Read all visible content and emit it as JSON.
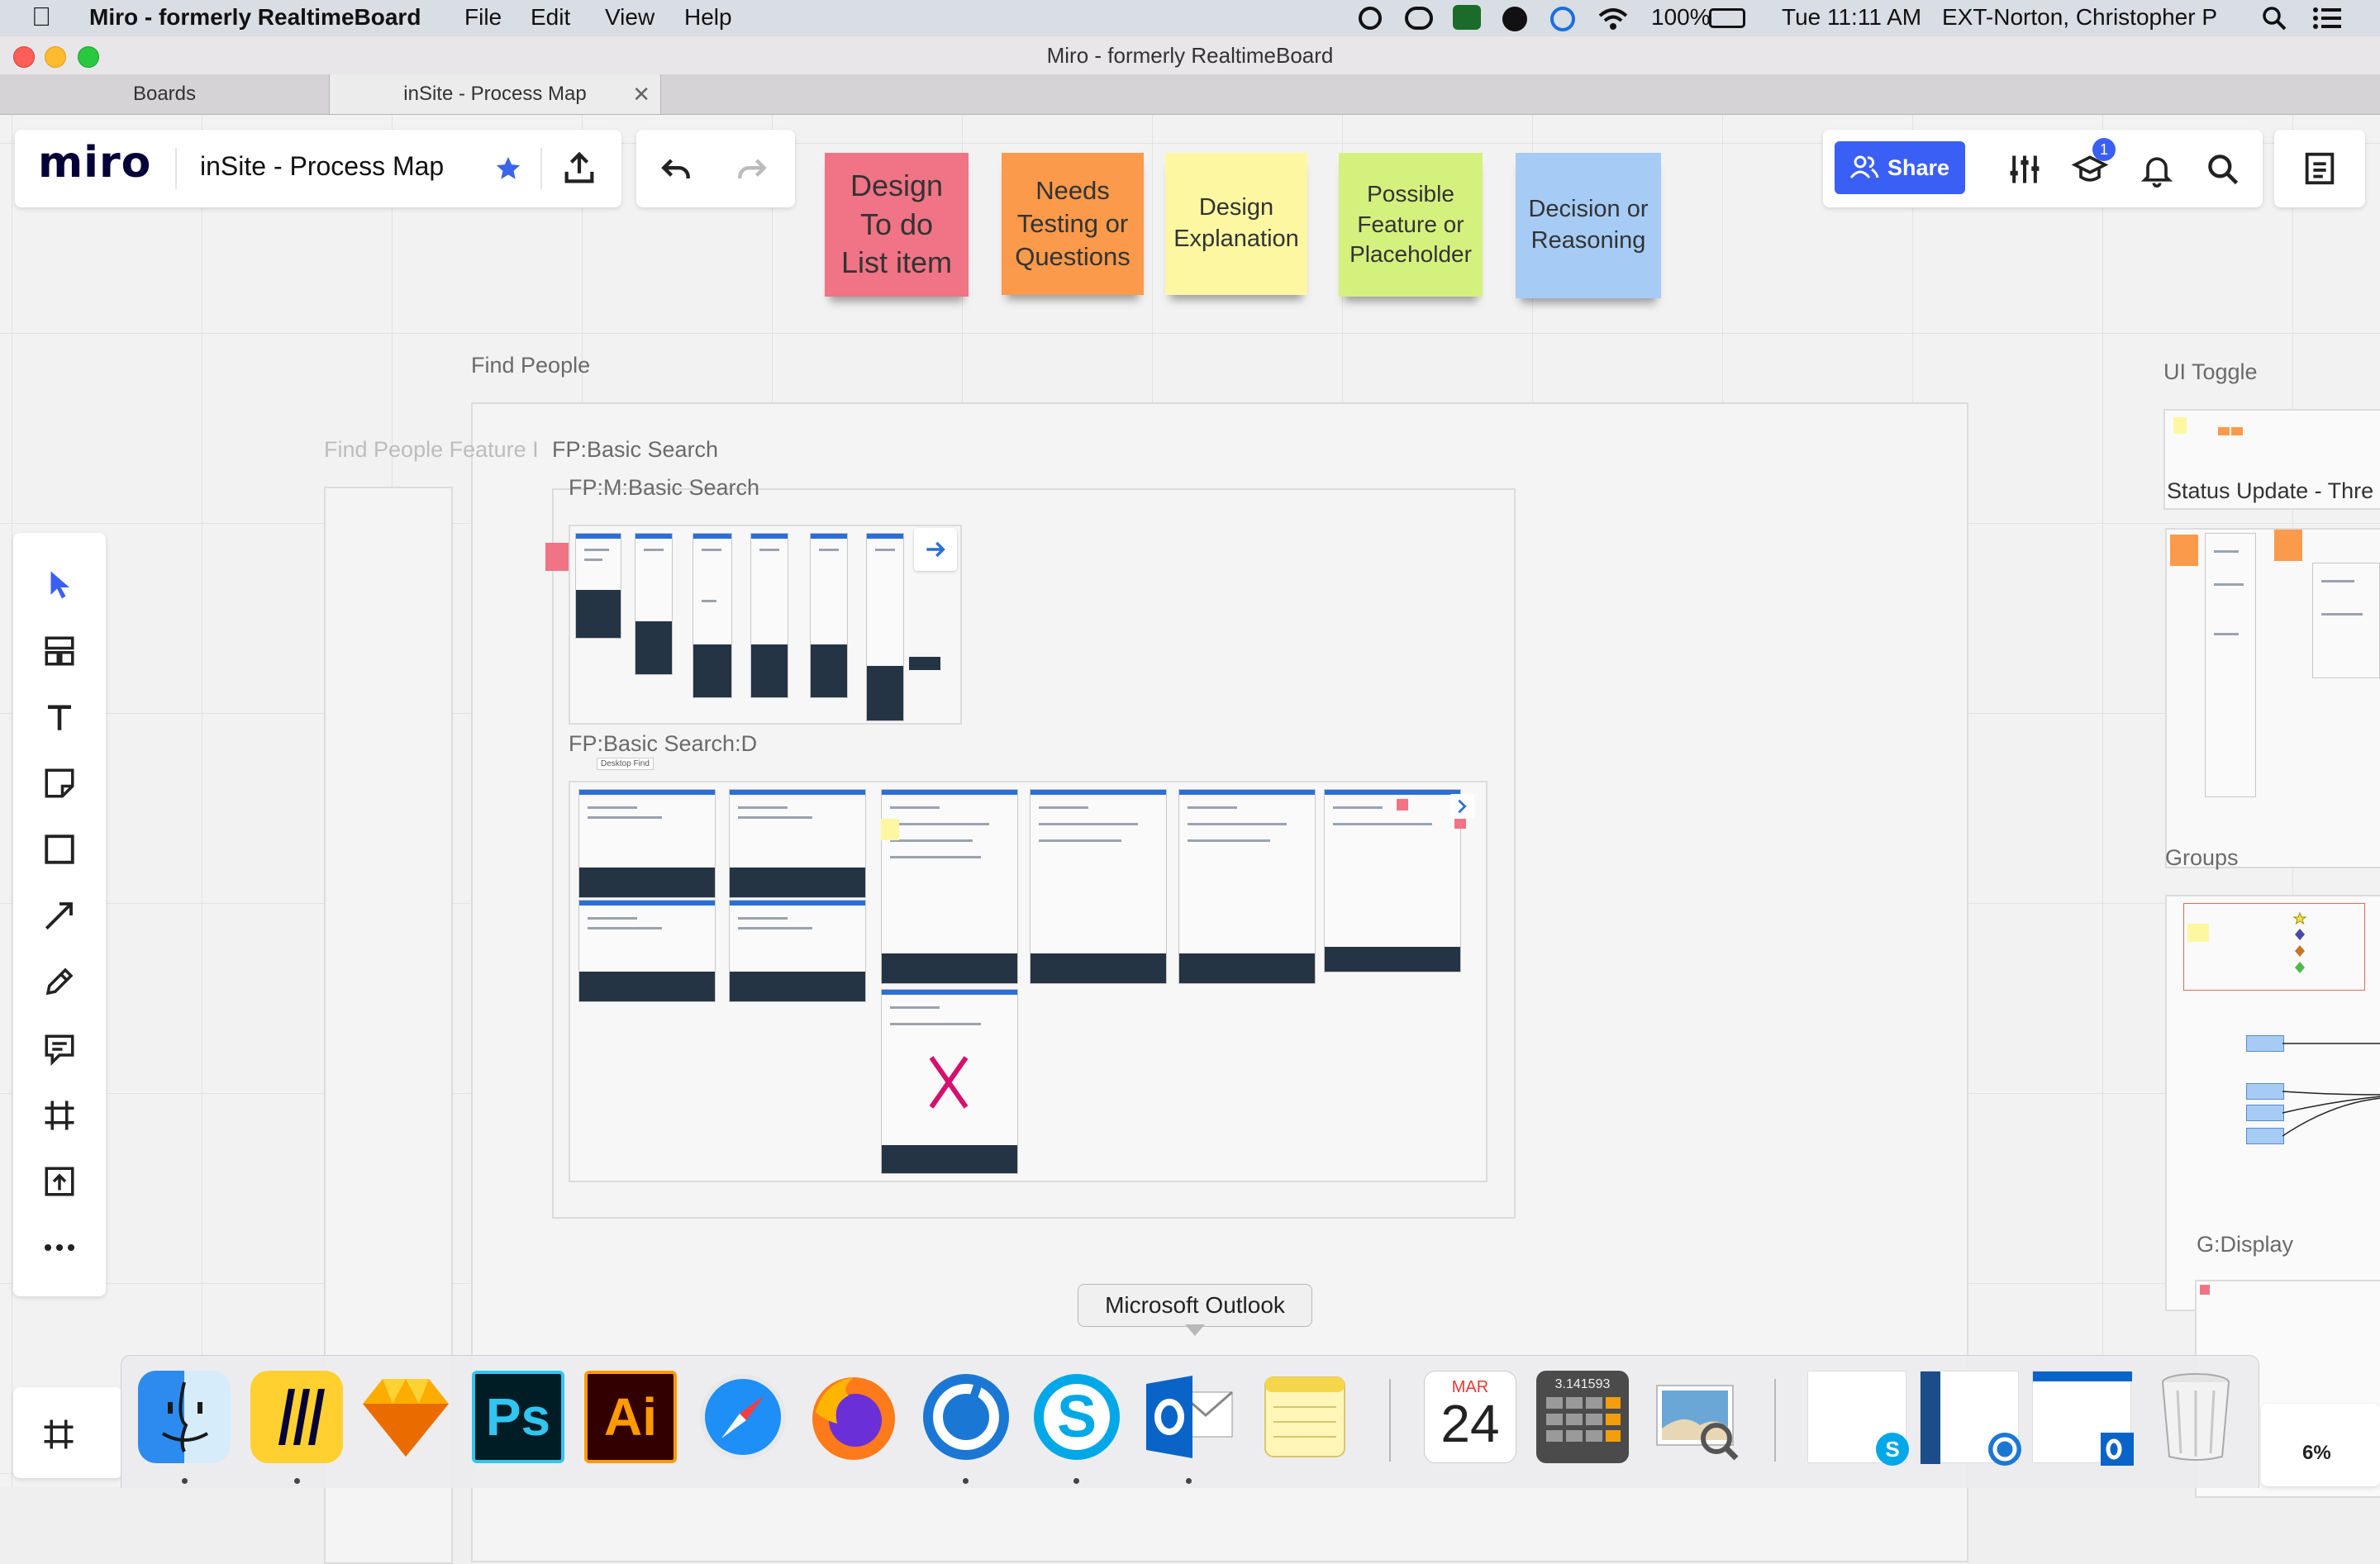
{
  "menubar": {
    "app_name": "Miro - formerly RealtimeBoard",
    "menus": [
      "File",
      "Edit",
      "View",
      "Help"
    ],
    "battery": "100%",
    "clock": "Tue 11:11 AM",
    "user": "EXT-Norton, Christopher P"
  },
  "window": {
    "title": "Miro - formerly RealtimeBoard"
  },
  "tabs": [
    {
      "label": "Boards"
    },
    {
      "label": "inSite - Process Map"
    }
  ],
  "board": {
    "logo": "miro",
    "name": "inSite - Process Map",
    "share_label": "Share",
    "notification_count": "1",
    "zoom": "6%"
  },
  "legend_stickies": [
    {
      "text": "Design To do List item",
      "color": "#f07386"
    },
    {
      "text": "Needs Testing or Questions",
      "color": "#fb9a4b"
    },
    {
      "text": "Design Explanation",
      "color": "#fdf7a1"
    },
    {
      "text": "Possible Feature or Placeholder",
      "color": "#d4f17e"
    },
    {
      "text": "Decision or Reasoning",
      "color": "#a6ccf5"
    }
  ],
  "frames": {
    "find_people": "Find People",
    "find_people_feature": "Find People Feature I",
    "fp_basic_search": "FP:Basic Search",
    "fp_m_basic_search": "FP:M:Basic Search",
    "fp_basic_search_d": "FP:Basic Search:D",
    "desktop_find": "Desktop Find",
    "ui_toggle": "UI Toggle",
    "status_update": "Status Update - Thre",
    "groups": "Groups",
    "g_display": "G:Display"
  },
  "tooltip": "Microsoft Outlook",
  "calendar": {
    "month": "MAR",
    "day": "24"
  },
  "calculator": "3.141593",
  "icons": {
    "dock": [
      "finder",
      "miro",
      "sketch",
      "photoshop",
      "illustrator",
      "safari",
      "firefox",
      "mattermost",
      "skype",
      "outlook",
      "mail",
      "notes",
      "calendar",
      "calculator",
      "preview",
      "trash"
    ]
  }
}
